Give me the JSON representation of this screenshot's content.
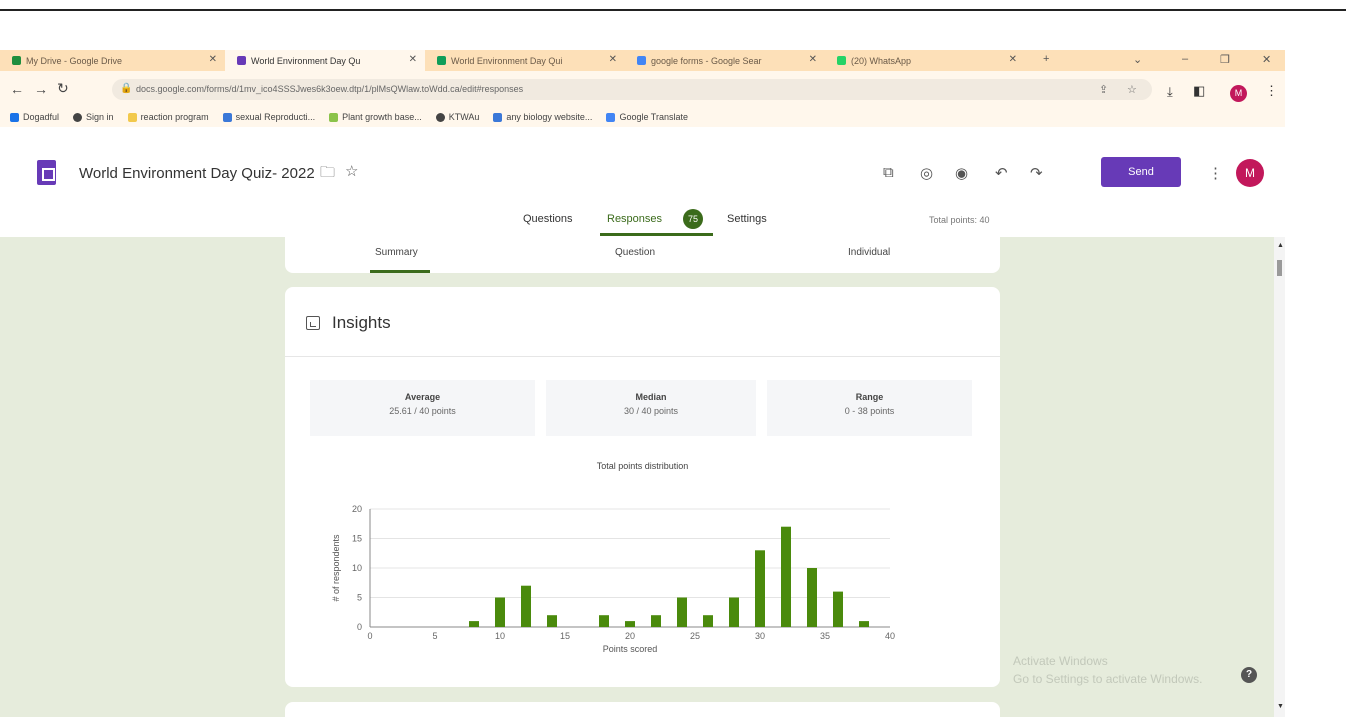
{
  "browser": {
    "tabs": [
      {
        "title": "My Drive - Google Drive",
        "color": "#1e8e3e",
        "active": false
      },
      {
        "title": "World Environment Day Qu",
        "color": "#673ab7",
        "active": true
      },
      {
        "title": "World Environment Day Qui",
        "color": "#0f9d58",
        "active": false
      },
      {
        "title": "google forms - Google Sear",
        "color": "#4285f4",
        "active": false
      },
      {
        "title": "(20) WhatsApp",
        "color": "#25d366",
        "active": false
      }
    ],
    "url": "docs.google.com/forms/d/1mv_ico4SSSJwes6k3oew.dtp/1/plMsQWlaw.toWdd.ca/edit#responses",
    "bookmarks": [
      "Dogadful",
      "Sign in",
      "reaction program",
      "sexual Reproducti...",
      "Plant growth base...",
      "KTWAu",
      "any biology website...",
      "Google Translate"
    ]
  },
  "forms": {
    "title": "World Environment Day Quiz- 2022",
    "send_label": "Send",
    "avatar_letter": "M",
    "tabs": {
      "questions": "Questions",
      "responses": "Responses",
      "settings": "Settings"
    },
    "response_count": "75",
    "total_points": "Total points: 40"
  },
  "summary_tabs": {
    "summary": "Summary",
    "question": "Question",
    "individual": "Individual"
  },
  "insights": {
    "title": "Insights",
    "stats": [
      {
        "label": "Average",
        "value": "25.61 / 40 points"
      },
      {
        "label": "Median",
        "value": "30 / 40 points"
      },
      {
        "label": "Range",
        "value": "0 - 38 points"
      }
    ]
  },
  "chart_data": {
    "type": "bar",
    "title": "Total points distribution",
    "xlabel": "Points scored",
    "ylabel": "# of respondents",
    "x": [
      8,
      10,
      12,
      14,
      16,
      18,
      20,
      22,
      24,
      26,
      28,
      30,
      32,
      34,
      36,
      38
    ],
    "values": [
      1,
      5,
      7,
      2,
      0,
      2,
      1,
      2,
      5,
      2,
      5,
      13,
      17,
      10,
      6,
      1
    ],
    "xlim": [
      0,
      40
    ],
    "ylim": [
      0,
      20
    ],
    "x_ticks": [
      0,
      5,
      10,
      15,
      20,
      25,
      30,
      35,
      40
    ],
    "y_ticks": [
      0,
      5,
      10,
      15,
      20
    ],
    "bar_color": "#4a8a0c",
    "grid": true
  },
  "windows": {
    "watermark_line1": "Activate Windows",
    "watermark_line2": "Go to Settings to activate Windows."
  }
}
